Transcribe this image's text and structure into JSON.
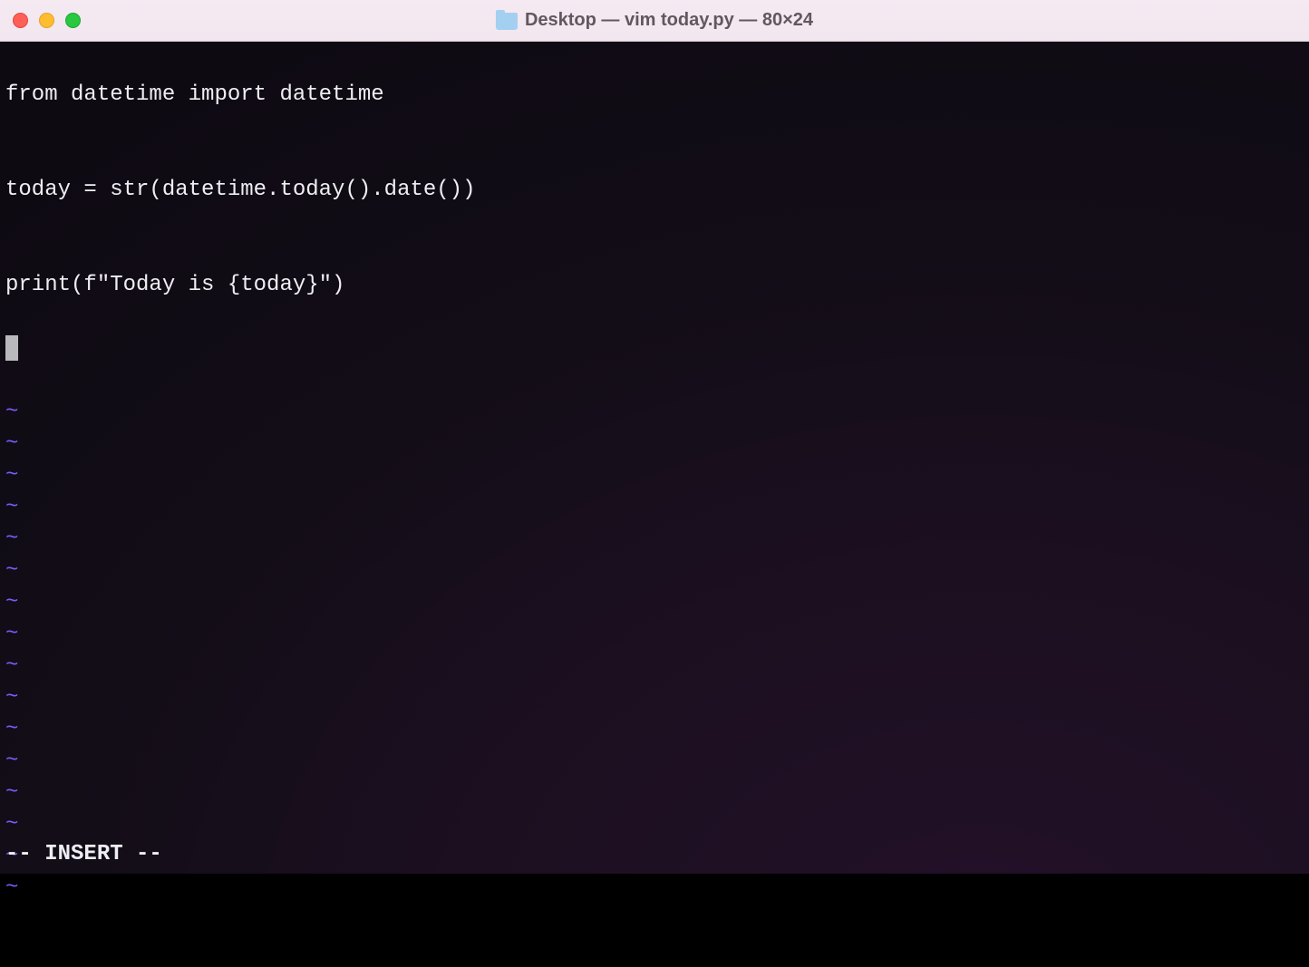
{
  "window": {
    "title": "Desktop — vim today.py — 80×24"
  },
  "editor": {
    "lines": [
      "from datetime import datetime",
      "",
      "today = str(datetime.today().date())",
      "",
      "print(f\"Today is {today}\")"
    ],
    "tilde": "~",
    "tilde_count": 16,
    "mode_line": "-- INSERT --"
  }
}
